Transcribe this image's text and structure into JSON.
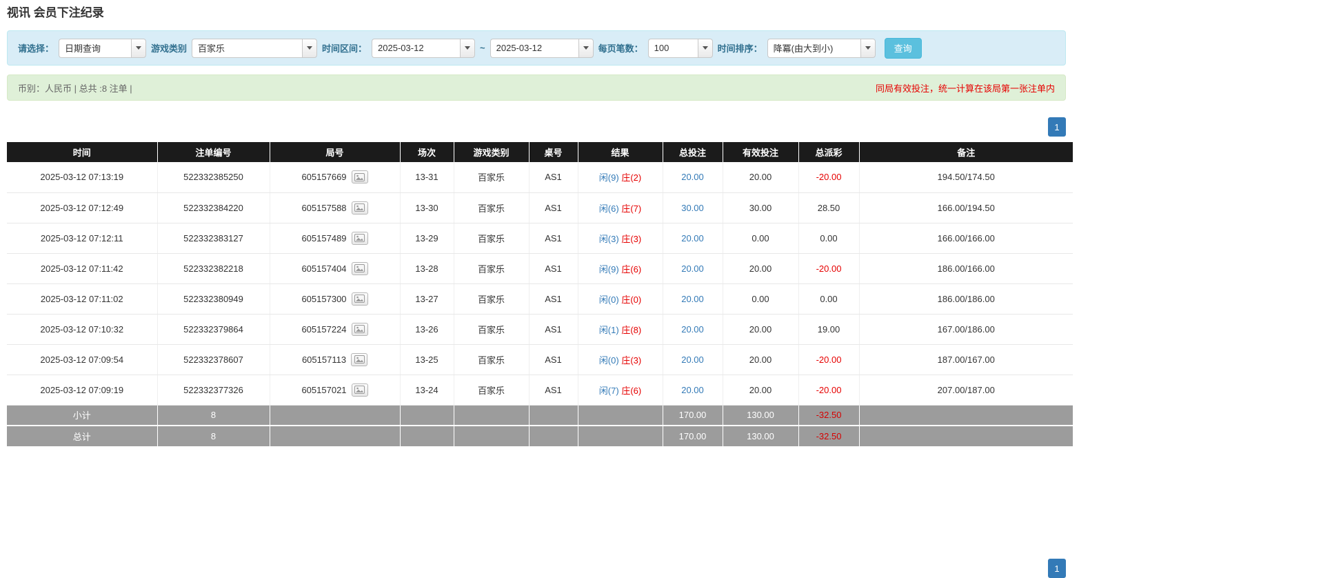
{
  "page": {
    "title": "视讯 会员下注纪录"
  },
  "colors": {
    "accent": "#337ab7",
    "info_button": "#5bc0de",
    "player_blue": "#337ab7",
    "banker_red": "#e60000",
    "negative": "#e60000"
  },
  "filters": {
    "select_label": "请选择：",
    "select_value": "日期查询",
    "game_type_label": "游戏类别",
    "game_type_value": "百家乐",
    "date_range_label": "时间区间：",
    "date_from": "2025-03-12",
    "date_separator": "~",
    "date_to": "2025-03-12",
    "page_size_label": "每页笔数：",
    "page_size_value": "100",
    "sort_label": "时间排序：",
    "sort_value": "降冪(由大到小)",
    "search_button": "查询"
  },
  "summary": {
    "left_text": "币别：人民币 | 总共 :8 注单 |",
    "right_note": "同局有效投注，统一计算在该局第一张注单内"
  },
  "pagination": {
    "current_page": "1"
  },
  "table": {
    "headers": [
      "时间",
      "注单编号",
      "局号",
      "场次",
      "游戏类别",
      "桌号",
      "结果",
      "总投注",
      "有效投注",
      "总派彩",
      "备注"
    ],
    "rows": [
      {
        "time": "2025-03-12 07:13:19",
        "bet_id": "522332385250",
        "round_id": "605157669",
        "session": "13-31",
        "game_type": "百家乐",
        "table_no": "AS1",
        "result_player": "闲(9)",
        "result_banker": "庄(2)",
        "total_bet": "20.00",
        "valid_bet": "20.00",
        "payout": "-20.00",
        "note": "194.50/174.50"
      },
      {
        "time": "2025-03-12 07:12:49",
        "bet_id": "522332384220",
        "round_id": "605157588",
        "session": "13-30",
        "game_type": "百家乐",
        "table_no": "AS1",
        "result_player": "闲(6)",
        "result_banker": "庄(7)",
        "total_bet": "30.00",
        "valid_bet": "30.00",
        "payout": "28.50",
        "note": "166.00/194.50"
      },
      {
        "time": "2025-03-12 07:12:11",
        "bet_id": "522332383127",
        "round_id": "605157489",
        "session": "13-29",
        "game_type": "百家乐",
        "table_no": "AS1",
        "result_player": "闲(3)",
        "result_banker": "庄(3)",
        "total_bet": "20.00",
        "valid_bet": "0.00",
        "payout": "0.00",
        "note": "166.00/166.00"
      },
      {
        "time": "2025-03-12 07:11:42",
        "bet_id": "522332382218",
        "round_id": "605157404",
        "session": "13-28",
        "game_type": "百家乐",
        "table_no": "AS1",
        "result_player": "闲(9)",
        "result_banker": "庄(6)",
        "total_bet": "20.00",
        "valid_bet": "20.00",
        "payout": "-20.00",
        "note": "186.00/166.00"
      },
      {
        "time": "2025-03-12 07:11:02",
        "bet_id": "522332380949",
        "round_id": "605157300",
        "session": "13-27",
        "game_type": "百家乐",
        "table_no": "AS1",
        "result_player": "闲(0)",
        "result_banker": "庄(0)",
        "total_bet": "20.00",
        "valid_bet": "0.00",
        "payout": "0.00",
        "note": "186.00/186.00"
      },
      {
        "time": "2025-03-12 07:10:32",
        "bet_id": "522332379864",
        "round_id": "605157224",
        "session": "13-26",
        "game_type": "百家乐",
        "table_no": "AS1",
        "result_player": "闲(1)",
        "result_banker": "庄(8)",
        "total_bet": "20.00",
        "valid_bet": "20.00",
        "payout": "19.00",
        "note": "167.00/186.00"
      },
      {
        "time": "2025-03-12 07:09:54",
        "bet_id": "522332378607",
        "round_id": "605157113",
        "session": "13-25",
        "game_type": "百家乐",
        "table_no": "AS1",
        "result_player": "闲(0)",
        "result_banker": "庄(3)",
        "total_bet": "20.00",
        "valid_bet": "20.00",
        "payout": "-20.00",
        "note": "187.00/167.00"
      },
      {
        "time": "2025-03-12 07:09:19",
        "bet_id": "522332377326",
        "round_id": "605157021",
        "session": "13-24",
        "game_type": "百家乐",
        "table_no": "AS1",
        "result_player": "闲(7)",
        "result_banker": "庄(6)",
        "total_bet": "20.00",
        "valid_bet": "20.00",
        "payout": "-20.00",
        "note": "207.00/187.00"
      }
    ],
    "subtotal": {
      "label": "小计",
      "count": "8",
      "total_bet": "170.00",
      "valid_bet": "130.00",
      "payout": "-32.50"
    },
    "total": {
      "label": "总计",
      "count": "8",
      "total_bet": "170.00",
      "valid_bet": "130.00",
      "payout": "-32.50"
    }
  }
}
